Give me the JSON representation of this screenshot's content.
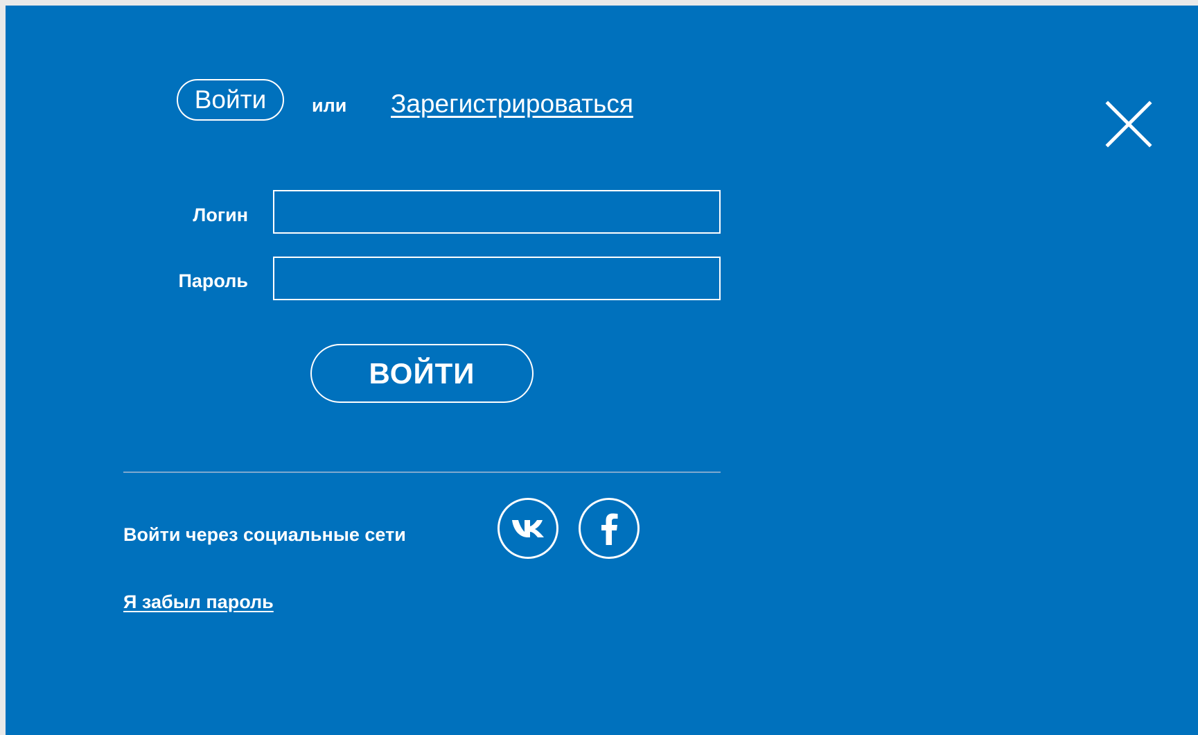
{
  "header": {
    "login_tab_label": "Войти",
    "or_text": "или",
    "register_label": "Зарегистрироваться",
    "close_icon": "close-icon"
  },
  "form": {
    "login_label": "Логин",
    "login_value": "",
    "password_label": "Пароль",
    "password_value": "",
    "submit_label": "ВОЙТИ"
  },
  "social": {
    "label": "Войти через социальные сети",
    "networks": [
      {
        "name": "vk",
        "icon": "vk-icon"
      },
      {
        "name": "facebook",
        "icon": "facebook-icon"
      }
    ]
  },
  "footer": {
    "forgot_label": "Я забыл пароль"
  },
  "colors": {
    "panel_background": "#0071bd",
    "foreground": "#ffffff",
    "divider": "#7fa9cf"
  }
}
